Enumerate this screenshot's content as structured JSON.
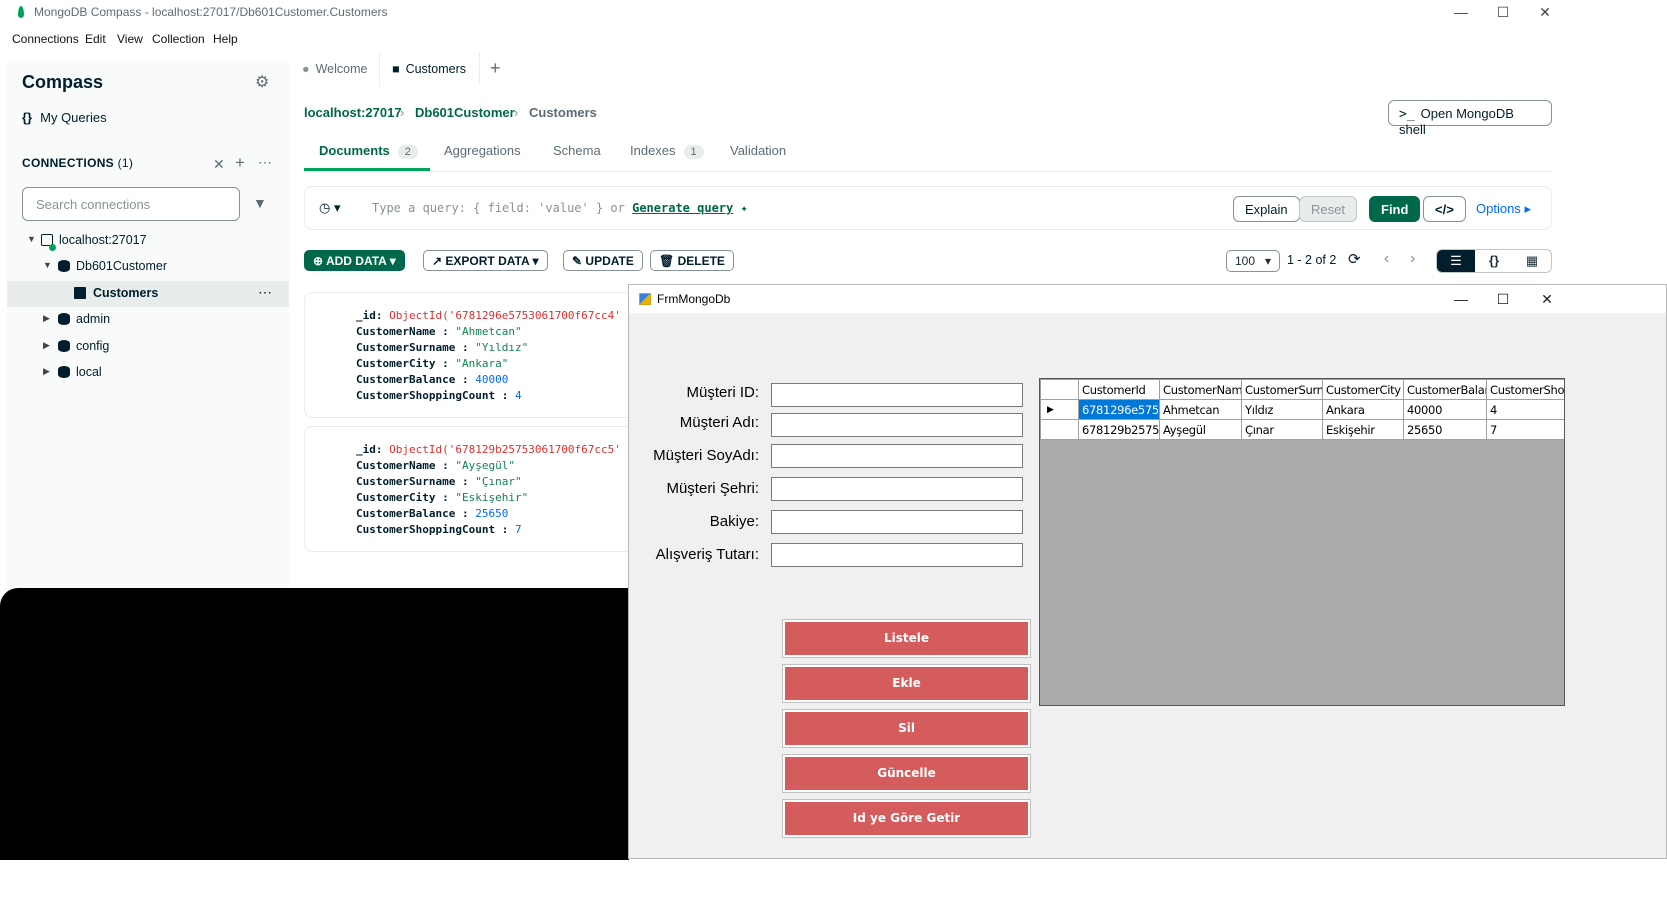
{
  "app": {
    "window_title": "MongoDB Compass - localhost:27017/Db601Customer.Customers",
    "menu": [
      "Connections",
      "Edit",
      "View",
      "Collection",
      "Help"
    ]
  },
  "sidebar": {
    "title": "Compass",
    "my_queries": "My Queries",
    "connections_label": "CONNECTIONS",
    "connections_count": "(1)",
    "search_placeholder": "Search connections",
    "tree": {
      "host": "localhost:27017",
      "db": "Db601Customer",
      "collection": "Customers",
      "admin": "admin",
      "config": "config",
      "local": "local"
    }
  },
  "tabs": {
    "welcome": "Welcome",
    "customers": "Customers",
    "add": "+"
  },
  "breadcrumb": {
    "host": "localhost:27017",
    "db": "Db601Customer",
    "collection": "Customers"
  },
  "shell_button": "Open MongoDB shell",
  "subtabs": {
    "documents": "Documents",
    "documents_count": "2",
    "aggregations": "Aggregations",
    "schema": "Schema",
    "indexes": "Indexes",
    "indexes_count": "1",
    "validation": "Validation"
  },
  "query": {
    "placeholder_prefix": "Type a query: { field: 'value' } or",
    "generate_link": "Generate query",
    "explain": "Explain",
    "reset": "Reset",
    "find": "Find",
    "options": "Options"
  },
  "toolbar": {
    "add_data": "ADD DATA",
    "export_data": "EXPORT DATA",
    "update": "UPDATE",
    "delete": "DELETE",
    "page_size": "100",
    "range": "1 - 2 of 2"
  },
  "documents": [
    {
      "id": "ObjectId('6781296e5753061700f67cc4'",
      "name": "\"Ahmetcan\"",
      "surname": "\"Yıldız\"",
      "city": "\"Ankara\"",
      "balance": "40000",
      "count": "4"
    },
    {
      "id": "ObjectId('678129b25753061700f67cc5'",
      "name": "\"Ayşegül\"",
      "surname": "\"Çınar\"",
      "city": "\"Eskişehir\"",
      "balance": "25650",
      "count": "7"
    }
  ],
  "field_keys": {
    "id": "_id:",
    "name": "CustomerName :",
    "surname": "CustomerSurname :",
    "city": "CustomerCity :",
    "balance": "CustomerBalance :",
    "count": "CustomerShoppingCount :"
  },
  "form": {
    "title": "FrmMongoDb",
    "labels": [
      "Müşteri ID:",
      "Müşteri Adı:",
      "Müşteri SoyAdı:",
      "Müşteri Şehri:",
      "Bakiye:",
      "Alışveriş Tutarı:"
    ],
    "buttons": [
      "Listele",
      "Ekle",
      "Sil",
      "Güncelle",
      "Id ye Göre Getir"
    ],
    "button_color": "#d45c5c",
    "grid": {
      "columns": [
        "CustomerId",
        "CustomerName",
        "CustomerSurnam",
        "CustomerCity",
        "CustomerBalanc",
        "CustomerShoppi"
      ],
      "rows": [
        [
          "6781296e575...",
          "Ahmetcan",
          "Yıldız",
          "Ankara",
          "40000",
          "4"
        ],
        [
          "678129b2575...",
          "Ayşegül",
          "Çınar",
          "Eskişehir",
          "25650",
          "7"
        ]
      ]
    }
  },
  "colors": {
    "accent": "#00684a",
    "accent_light": "#00a35c",
    "selection": "#0078d7"
  }
}
